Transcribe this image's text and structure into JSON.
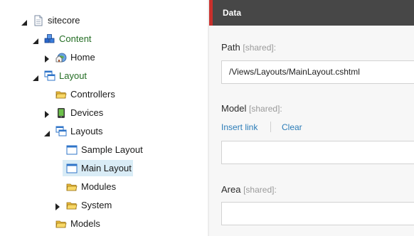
{
  "tree": {
    "items": [
      {
        "label": "sitecore",
        "icon": "sitecore-page-icon",
        "state": "expanded",
        "style": "normal"
      },
      {
        "label": "Content",
        "icon": "content-cubes-icon",
        "state": "expanded",
        "style": "green"
      },
      {
        "label": "Home",
        "icon": "home-globe-icon",
        "state": "collapsed",
        "style": "normal"
      },
      {
        "label": "Layout",
        "icon": "layout-windows-icon",
        "state": "expanded",
        "style": "green"
      },
      {
        "label": "Controllers",
        "icon": "folder-icon",
        "state": "leaf",
        "style": "normal"
      },
      {
        "label": "Devices",
        "icon": "device-icon",
        "state": "collapsed",
        "style": "normal"
      },
      {
        "label": "Layouts",
        "icon": "layouts-windows-icon",
        "state": "expanded",
        "style": "normal"
      },
      {
        "label": "Sample Layout",
        "icon": "layout-file-icon",
        "state": "leaf",
        "style": "normal"
      },
      {
        "label": "Main Layout",
        "icon": "layout-file-icon",
        "state": "leaf",
        "style": "selected"
      },
      {
        "label": "Modules",
        "icon": "folder-icon",
        "state": "leaf",
        "style": "normal"
      },
      {
        "label": "System",
        "icon": "folder-icon",
        "state": "collapsed",
        "style": "normal"
      },
      {
        "label": "Models",
        "icon": "folder-icon",
        "state": "leaf",
        "style": "normal"
      }
    ],
    "selected": "Main Layout"
  },
  "editor": {
    "section_title": "Data",
    "fields": {
      "path": {
        "label": "Path",
        "shared": "[shared]:",
        "value": "/Views/Layouts/MainLayout.cshtml"
      },
      "model": {
        "label": "Model",
        "shared": "[shared]:",
        "insert_link": "Insert link",
        "clear": "Clear",
        "value": ""
      },
      "area": {
        "label": "Area",
        "shared": "[shared]:",
        "value": ""
      }
    }
  },
  "colors": {
    "header_bg": "#474747",
    "header_accent": "#c9302c",
    "link": "#2b7cb8",
    "green_label": "#256e25",
    "selected_bg": "#d9ecf6"
  }
}
